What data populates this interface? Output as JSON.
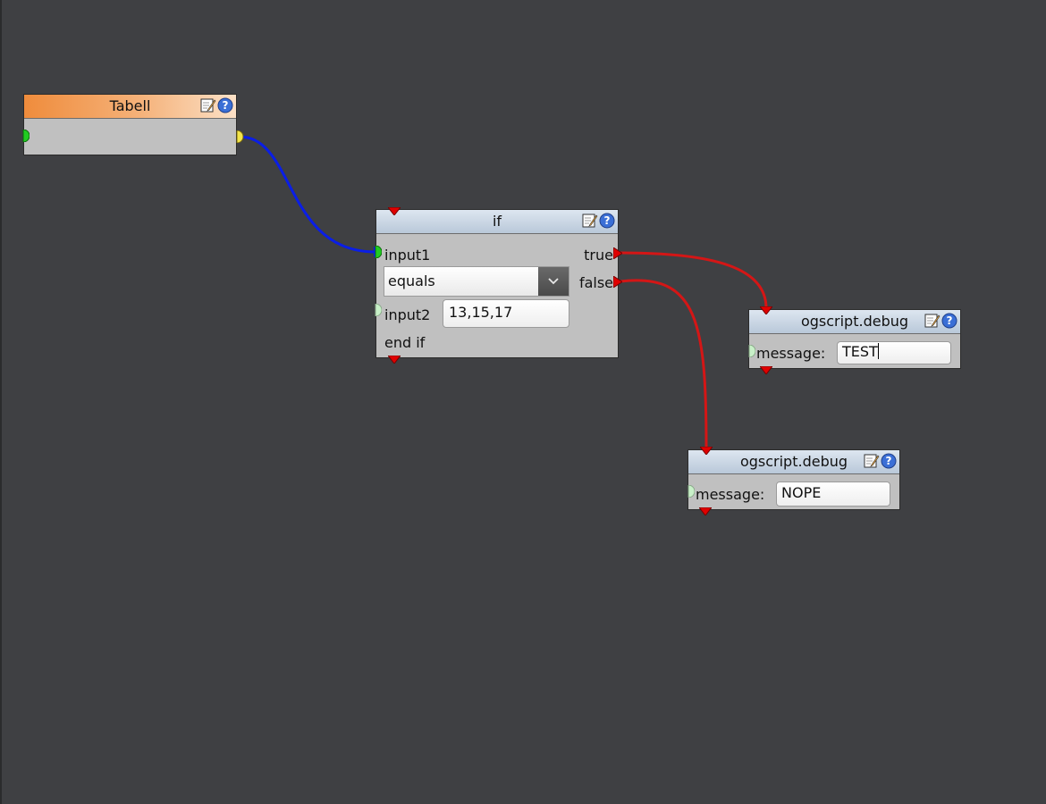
{
  "colors": {
    "canvas_bg": "#3f4043",
    "data_wire": "#0a1ee6",
    "flow_wire": "#d41616",
    "flow_port": "#e00000",
    "data_input_port": "#22cc22",
    "data_output_port": "#f2e44a",
    "node_body": "#c0c0c0",
    "header_blue": "#c7d3e1",
    "header_orange": "#ef8c3c"
  },
  "nodes": {
    "tabell": {
      "title": "Tabell",
      "icons": [
        "edit-icon",
        "help-icon"
      ]
    },
    "if_node": {
      "title": "if",
      "input1_label": "input1",
      "operator_value": "equals",
      "input2_label": "input2",
      "input2_value": "13,15,17",
      "true_label": "true",
      "false_label": "false",
      "end_label": "end if",
      "icons": [
        "edit-icon",
        "help-icon"
      ]
    },
    "debug_true": {
      "title": "ogscript.debug",
      "message_label": "message:",
      "message_value": "TEST",
      "icons": [
        "edit-icon",
        "help-icon"
      ]
    },
    "debug_false": {
      "title": "ogscript.debug",
      "message_label": "message:",
      "message_value": "NOPE",
      "icons": [
        "edit-icon",
        "help-icon"
      ]
    }
  }
}
